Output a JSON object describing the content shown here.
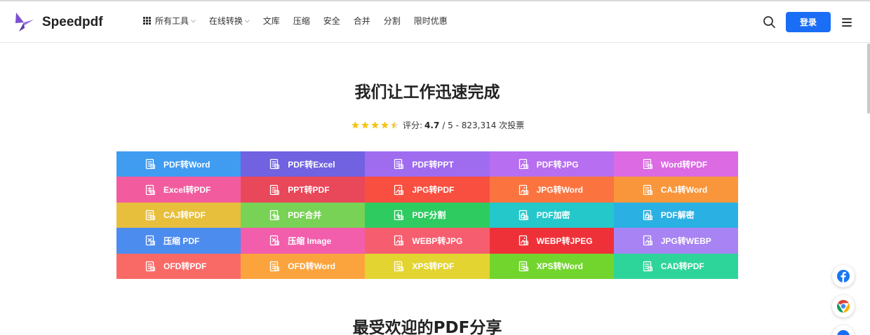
{
  "header": {
    "logo_text": "Speedpdf",
    "nav": [
      {
        "label": "所有工具",
        "has_grid_icon": true,
        "has_dropdown": true
      },
      {
        "label": "在线转换",
        "has_grid_icon": false,
        "has_dropdown": true
      },
      {
        "label": "文库"
      },
      {
        "label": "压缩"
      },
      {
        "label": "安全"
      },
      {
        "label": "合并"
      },
      {
        "label": "分割"
      },
      {
        "label": "限时优惠"
      }
    ],
    "login_label": "登录",
    "accent_color": "#1a6ef5"
  },
  "hero": {
    "title": "我们让工作迅速完成",
    "rating": {
      "label": "评分:",
      "score": "4.7",
      "rest": "/ 5 - 823,314 次投票",
      "stars_value": 4.5
    }
  },
  "tools": [
    {
      "label": "PDF转Word",
      "color": "#3f9cf1",
      "icon": "document-icon"
    },
    {
      "label": "PDF转Excel",
      "color": "#7062e0",
      "icon": "document-icon"
    },
    {
      "label": "PDF转PPT",
      "color": "#9f6cf0",
      "icon": "document-icon"
    },
    {
      "label": "PDF转JPG",
      "color": "#b76ef0",
      "icon": "image-icon"
    },
    {
      "label": "Word转PDF",
      "color": "#db6ae3",
      "icon": "document-icon"
    },
    {
      "label": "Excel转PDF",
      "color": "#f25c9f",
      "icon": "table-icon"
    },
    {
      "label": "PPT转PDF",
      "color": "#e9485a",
      "icon": "slides-icon"
    },
    {
      "label": "JPG转PDF",
      "color": "#f84f40",
      "icon": "image-icon"
    },
    {
      "label": "JPG转Word",
      "color": "#fb7440",
      "icon": "image-icon"
    },
    {
      "label": "CAJ转Word",
      "color": "#f9963b",
      "icon": "caj-icon"
    },
    {
      "label": "CAJ转PDF",
      "color": "#e8bf3c",
      "icon": "caj-icon"
    },
    {
      "label": "PDF合并",
      "color": "#78d255",
      "icon": "merge-icon"
    },
    {
      "label": "PDF分割",
      "color": "#2ecb60",
      "icon": "split-icon"
    },
    {
      "label": "PDF加密",
      "color": "#24c8cb",
      "icon": "lock-icon"
    },
    {
      "label": "PDF解密",
      "color": "#2bb0e3",
      "icon": "unlock-icon"
    },
    {
      "label": "压缩 PDF",
      "color": "#4d8cef",
      "icon": "compress-icon"
    },
    {
      "label": "压缩 Image",
      "color": "#f25eab",
      "icon": "compress-icon"
    },
    {
      "label": "WEBP转JPG",
      "color": "#f65e6f",
      "icon": "image-icon"
    },
    {
      "label": "WEBP转JPEG",
      "color": "#ee3138",
      "icon": "image-icon"
    },
    {
      "label": "JPG转WEBP",
      "color": "#a883f3",
      "icon": "image-icon"
    },
    {
      "label": "OFD转PDF",
      "color": "#f96a67",
      "icon": "ofd-icon"
    },
    {
      "label": "OFD转Word",
      "color": "#fba43d",
      "icon": "ofd-icon"
    },
    {
      "label": "XPS转PDF",
      "color": "#e3d432",
      "icon": "xps-icon"
    },
    {
      "label": "XPS转Word",
      "color": "#72d52e",
      "icon": "xps-icon"
    },
    {
      "label": "CAD转PDF",
      "color": "#2ed59a",
      "icon": "cad-icon"
    }
  ],
  "share_section": {
    "title": "最受欢迎的PDF分享"
  },
  "social": [
    {
      "name": "facebook-icon",
      "color": "#1877f2"
    },
    {
      "name": "chrome-icon",
      "color": "#db4437"
    },
    {
      "name": "partial-icon",
      "color": "#1a6ef5"
    }
  ]
}
